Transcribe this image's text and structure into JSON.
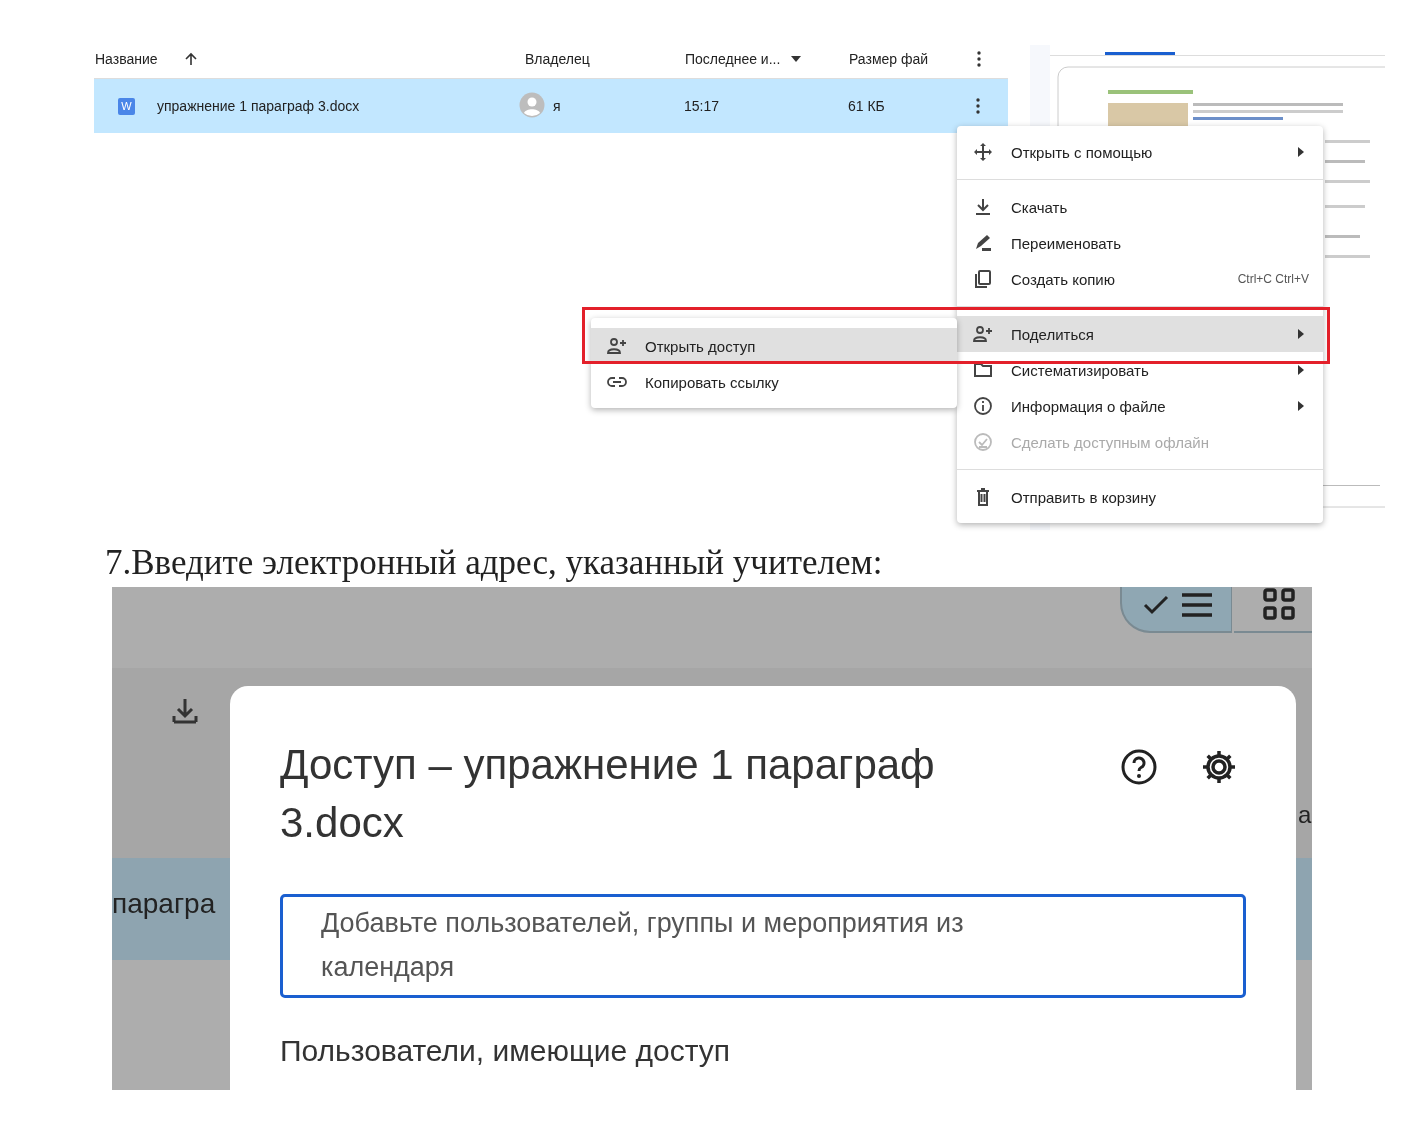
{
  "file_list": {
    "columns": [
      {
        "label": "Название",
        "sort_arrow": true,
        "dropdown": false
      },
      {
        "label": "Владелец",
        "sort_arrow": false,
        "dropdown": false
      },
      {
        "label": "Последнее и...",
        "sort_arrow": false,
        "dropdown": true
      },
      {
        "label": "Размер фай",
        "sort_arrow": false,
        "dropdown": false
      }
    ],
    "rows": [
      {
        "name": "упражнение 1 параграф 3.docx",
        "file_type": "W",
        "owner": "я",
        "modified": "15:17",
        "size": "61 КБ",
        "selected": true
      }
    ]
  },
  "context_menu": {
    "sections": [
      [
        {
          "label": "Открыть с помощью",
          "submenu": true,
          "selected": false,
          "disabled": false
        }
      ],
      [
        {
          "label": "Скачать",
          "submenu": false,
          "selected": false,
          "disabled": false
        },
        {
          "label": "Переименовать",
          "submenu": false,
          "selected": false,
          "disabled": false
        },
        {
          "label": "Создать копию",
          "shortcut": "Ctrl+C Ctrl+V",
          "submenu": false,
          "selected": false,
          "disabled": false
        }
      ],
      [
        {
          "label": "Поделиться",
          "submenu": true,
          "selected": true,
          "disabled": false
        },
        {
          "label": "Систематизировать",
          "submenu": true,
          "selected": false,
          "disabled": false
        },
        {
          "label": "Информация о файле",
          "submenu": true,
          "selected": false,
          "disabled": false
        },
        {
          "label": "Сделать доступным офлайн",
          "submenu": false,
          "selected": false,
          "disabled": true
        }
      ],
      [
        {
          "label": "Отправить в корзину",
          "submenu": false,
          "selected": false,
          "disabled": false
        }
      ]
    ]
  },
  "share_submenu": {
    "items": [
      {
        "label": "Открыть доступ",
        "selected": true
      },
      {
        "label": "Копировать ссылку",
        "selected": false
      }
    ]
  },
  "instruction": "7.Введите электронный адрес, указанный учителем:",
  "background": {
    "row_text": "парагра",
    "edge_text": "а",
    "view_buttons": [
      {
        "kind": "list",
        "selected": true
      },
      {
        "kind": "grid",
        "selected": false
      }
    ]
  },
  "share_dialog": {
    "title": "Доступ – упражнение 1 параграф 3.docx",
    "add_people": {
      "placeholder": "Добавьте пользователей, группы и мероприятия из календаря"
    },
    "people_heading": "Пользователи, имеющие доступ"
  }
}
